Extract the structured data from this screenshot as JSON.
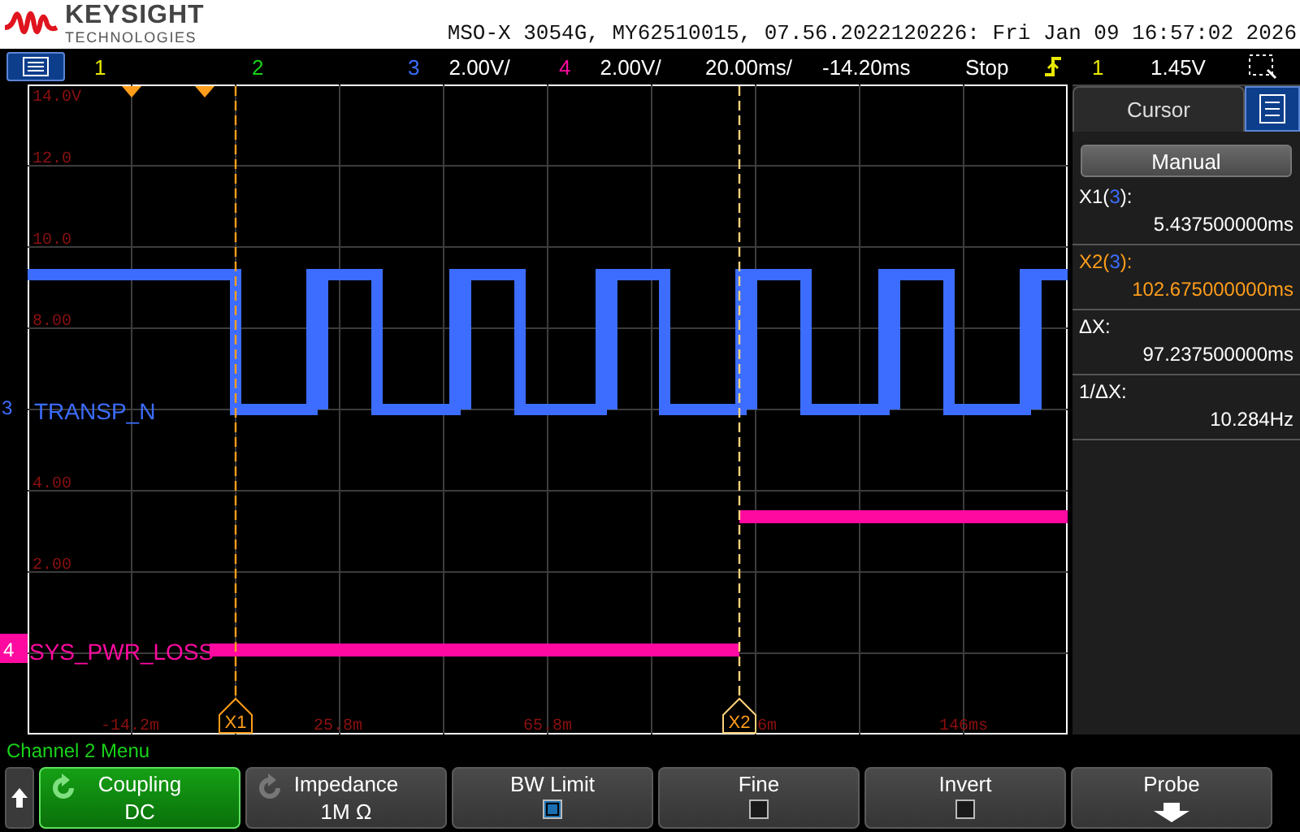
{
  "header": {
    "brand": "KEYSIGHT",
    "brand_sub": "TECHNOLOGIES",
    "title": "MSO-X 3054G, MY62510015, 07.56.2022120226: Fri Jan 09 16:57:02 2026"
  },
  "status_bar": {
    "channels": [
      {
        "label": "1",
        "color": "#e8e800"
      },
      {
        "label": "2",
        "color": "#19d219"
      },
      {
        "label": "3",
        "color": "#3c6dff",
        "scale": "2.00V/"
      },
      {
        "label": "4",
        "color": "#ff0aa0",
        "scale": "2.00V/"
      }
    ],
    "timebase": "20.00ms/",
    "delay": "-14.20ms",
    "run_state": "Stop",
    "trigger": {
      "source": "1",
      "level": "1.45V"
    }
  },
  "display": {
    "y_labels": [
      "14.0V",
      "12.0",
      "10.0",
      "8.00",
      "4.00",
      "2.00"
    ],
    "x_labels": [
      "-14.2m",
      "25.8m",
      "65.8m",
      "6m",
      "146ms"
    ],
    "traces": [
      {
        "channel": "3",
        "label": "TRANSP_N",
        "color": "#3c6dff"
      },
      {
        "channel": "4",
        "label": "SYS_PWR_LOSS",
        "color": "#ff0aa0"
      }
    ],
    "cursors": [
      {
        "label": "X1",
        "selected": false
      },
      {
        "label": "X2",
        "selected": true
      }
    ]
  },
  "cursor_panel": {
    "title": "Cursor",
    "mode": "Manual",
    "readings": [
      {
        "prefix": "X1(",
        "source": "3",
        "suffix": "):",
        "value": "5.437500000ms",
        "selected": false
      },
      {
        "prefix": "X2(",
        "source": "3",
        "suffix": "):",
        "value": "102.675000000ms",
        "selected": true
      },
      {
        "prefix": "ΔX:",
        "value": "97.237500000ms",
        "selected": false
      },
      {
        "prefix": "1/ΔX:",
        "value": "10.284Hz",
        "selected": false
      }
    ]
  },
  "menu": {
    "title": "Channel 2 Menu",
    "buttons": [
      {
        "kind": "dial",
        "label": "Coupling",
        "value": "DC",
        "selected": true
      },
      {
        "kind": "dial",
        "label": "Impedance",
        "value": "1M Ω",
        "selected": false
      },
      {
        "kind": "checkbox",
        "label": "BW Limit",
        "checked": true,
        "selected": false
      },
      {
        "kind": "checkbox",
        "label": "Fine",
        "checked": false,
        "selected": false
      },
      {
        "kind": "checkbox",
        "label": "Invert",
        "checked": false,
        "selected": false
      },
      {
        "kind": "arrow",
        "label": "Probe",
        "selected": false
      }
    ]
  }
}
